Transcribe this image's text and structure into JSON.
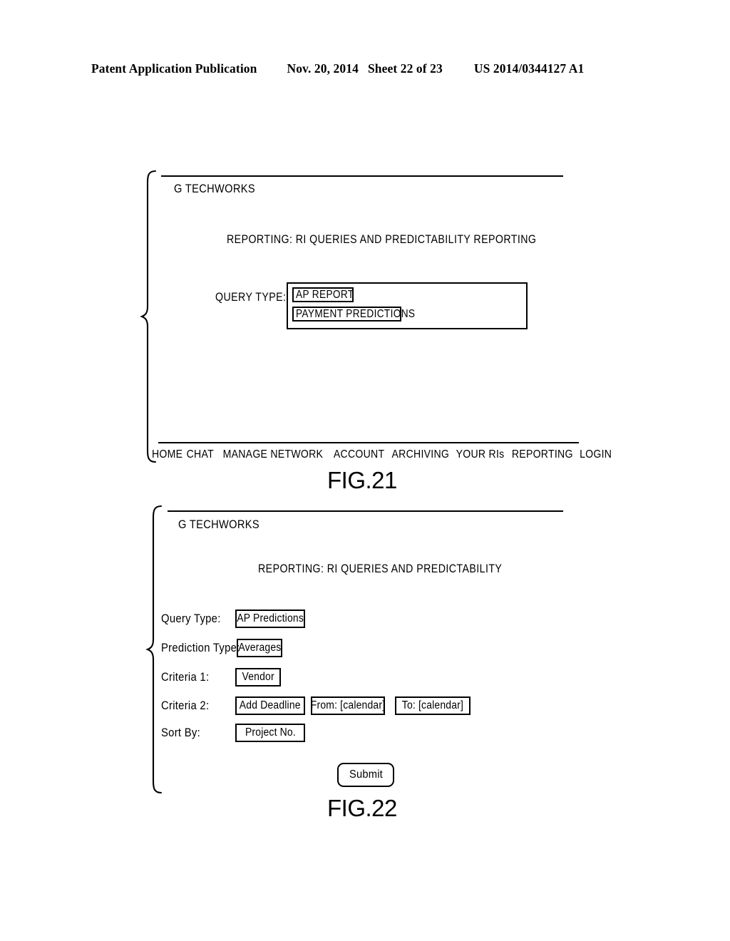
{
  "patent_header": {
    "publication": "Patent Application Publication",
    "date": "Nov. 20, 2014",
    "sheet": "Sheet 22 of 23",
    "number": "US 2014/0344127 A1"
  },
  "fig21": {
    "caption": "FIG.21",
    "brand": "G  TECHWORKS",
    "title": "REPORTING: RI  QUERIES  AND  PREDICTABILITY  REPORTING",
    "query_type": {
      "label": "QUERY TYPE:",
      "options": [
        "AP  REPORT",
        "PAYMENT  PREDICTIONS"
      ]
    },
    "nav": [
      "HOME",
      "CHAT",
      "MANAGE NETWORK",
      "ACCOUNT",
      "ARCHIVING",
      "YOUR RIs",
      "REPORTING",
      "LOGIN"
    ]
  },
  "fig22": {
    "caption": "FIG.22",
    "brand": "G  TECHWORKS",
    "title": "REPORTING: RI  QUERIES  AND  PREDICTABILITY",
    "rows": [
      {
        "label": "Query  Type:",
        "value": "AP  Predictions"
      },
      {
        "label": "Prediction  Type:",
        "value": "Averages"
      },
      {
        "label": "Criteria  1:",
        "value": "Vendor"
      },
      {
        "label": "Criteria  2:",
        "value": "Add  Deadline",
        "from": "From: [calendar]",
        "to": "To: [calendar]"
      },
      {
        "label": "Sort  By:",
        "value": "Project  No."
      }
    ],
    "submit_label": "Submit"
  }
}
